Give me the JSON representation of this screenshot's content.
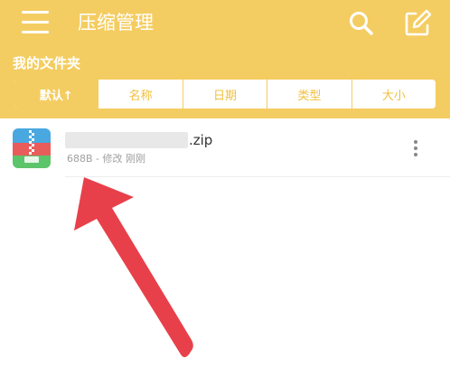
{
  "header": {
    "title": "压缩管理",
    "menu_icon": "hamburger-menu-icon",
    "search_icon": "search-icon",
    "edit_icon": "edit-icon",
    "background": "#f4cd62"
  },
  "folder": {
    "label": "我的文件夹"
  },
  "sort_tabs": [
    {
      "label": "默认↑",
      "active": true
    },
    {
      "label": "名称",
      "active": false
    },
    {
      "label": "日期",
      "active": false
    },
    {
      "label": "类型",
      "active": false
    },
    {
      "label": "大小",
      "active": false
    }
  ],
  "files": [
    {
      "name_visible": ".zip",
      "meta": "688B - 修改 刚刚",
      "icon": "zip-archive-icon"
    }
  ],
  "colors": {
    "accent": "#f4cd62",
    "arrow": "#e8404a",
    "zip_icon_blue": "#4aa8e0",
    "zip_icon_red": "#e85c5c",
    "zip_icon_green": "#5cc46a"
  }
}
